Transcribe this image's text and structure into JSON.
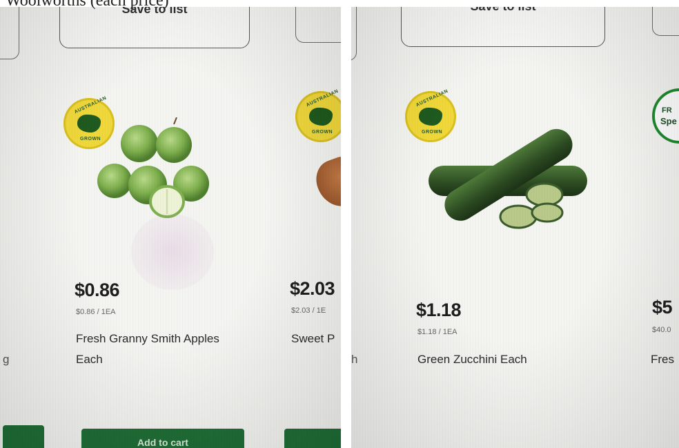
{
  "caption": "Woolworths (each price)",
  "left_panel": {
    "save_button": "Save to list",
    "badge_text_top": "AUSTRALIAN",
    "badge_text_bottom": "GROWN",
    "product": {
      "price": "$0.86",
      "unit_price": "$0.86 / 1EA",
      "name_line1": "Fresh Granny Smith Apples",
      "name_line2": "Each",
      "image": "granny-smith-apples"
    },
    "next_product": {
      "price": "$2.03",
      "unit_price": "$2.03 / 1E",
      "name": "Sweet P",
      "badge_text_top": "AUSTRALIAN",
      "badge_text_bottom": "GROWN"
    },
    "prev_fragment": "g",
    "add_to_cart": "Add to cart"
  },
  "right_panel": {
    "save_button": "Save to list",
    "badge_text_top": "AUSTRALIAN",
    "badge_text_bottom": "GROWN",
    "product": {
      "price": "$1.18",
      "unit_price": "$1.18 / 1EA",
      "name": "Green Zucchini Each",
      "image": "green-zucchini"
    },
    "next_product": {
      "price": "$5",
      "unit_price": "$40.0",
      "name": "Fres",
      "badge_line1": "FR",
      "badge_line2": "Spe"
    },
    "prev_fragment": "h"
  },
  "colors": {
    "brand_green": "#1f6e36",
    "badge_yellow": "#f0d83a",
    "fresh_green": "#1f8a2e"
  }
}
